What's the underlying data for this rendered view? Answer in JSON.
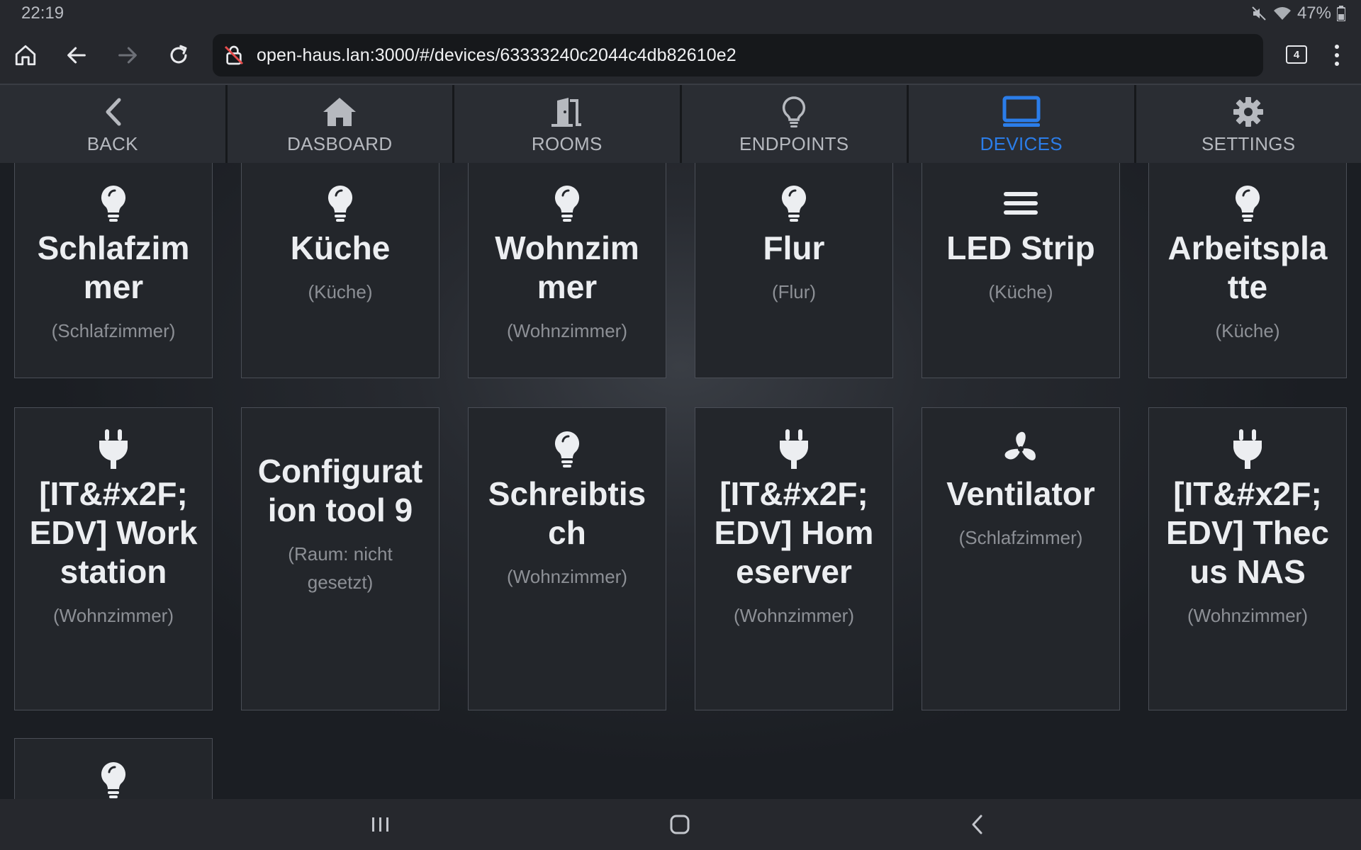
{
  "status_bar": {
    "time": "22:19",
    "battery": "47%"
  },
  "browser": {
    "url": "open-haus.lan:3000/#/devices/63333240c2044c4db82610e2",
    "tab_count": "4"
  },
  "app_nav": [
    {
      "label": "BACK",
      "icon": "chevron-left-icon",
      "active": false
    },
    {
      "label": "DASBOARD",
      "icon": "home-icon",
      "active": false
    },
    {
      "label": "ROOMS",
      "icon": "door-icon",
      "active": false
    },
    {
      "label": "ENDPOINTS",
      "icon": "lightbulb-outline-icon",
      "active": false
    },
    {
      "label": "DEVICES",
      "icon": "monitor-icon",
      "active": true
    },
    {
      "label": "SETTINGS",
      "icon": "gear-icon",
      "active": false
    }
  ],
  "colors": {
    "accent": "#2b7de9",
    "card_bg": "#23262b",
    "card_border": "#4a4e56"
  },
  "devices": [
    {
      "name": "Schlafzimmer",
      "room": "(Schlafzimmer)",
      "icon": "lightbulb-icon"
    },
    {
      "name": "Küche",
      "room": "(Küche)",
      "icon": "lightbulb-icon"
    },
    {
      "name": "Wohnzimmer",
      "room": "(Wohnzimmer)",
      "icon": "lightbulb-icon"
    },
    {
      "name": "Flur",
      "room": "(Flur)",
      "icon": "lightbulb-icon"
    },
    {
      "name": "LED Strip",
      "room": "(Küche)",
      "icon": "menu-lines-icon"
    },
    {
      "name": "Arbeitsplatte",
      "room": "(Küche)",
      "icon": "lightbulb-icon"
    },
    {
      "name": "[IT&#x2F;EDV] Workstation",
      "room": "(Wohnzimmer)",
      "icon": "plug-icon"
    },
    {
      "name": "Configuration tool 9",
      "room": "(Raum: nicht gesetzt)",
      "icon": ""
    },
    {
      "name": "Schreibtisch",
      "room": "(Wohnzimmer)",
      "icon": "lightbulb-icon"
    },
    {
      "name": "[IT&#x2F;EDV] Homeserver",
      "room": "(Wohnzimmer)",
      "icon": "plug-icon"
    },
    {
      "name": "Ventilator",
      "room": "(Schlafzimmer)",
      "icon": "fan-icon"
    },
    {
      "name": "[IT&#x2F;EDV] Thecus NAS",
      "room": "(Wohnzimmer)",
      "icon": "plug-icon"
    },
    {
      "name": "",
      "room": "",
      "icon": "lightbulb-icon"
    }
  ]
}
